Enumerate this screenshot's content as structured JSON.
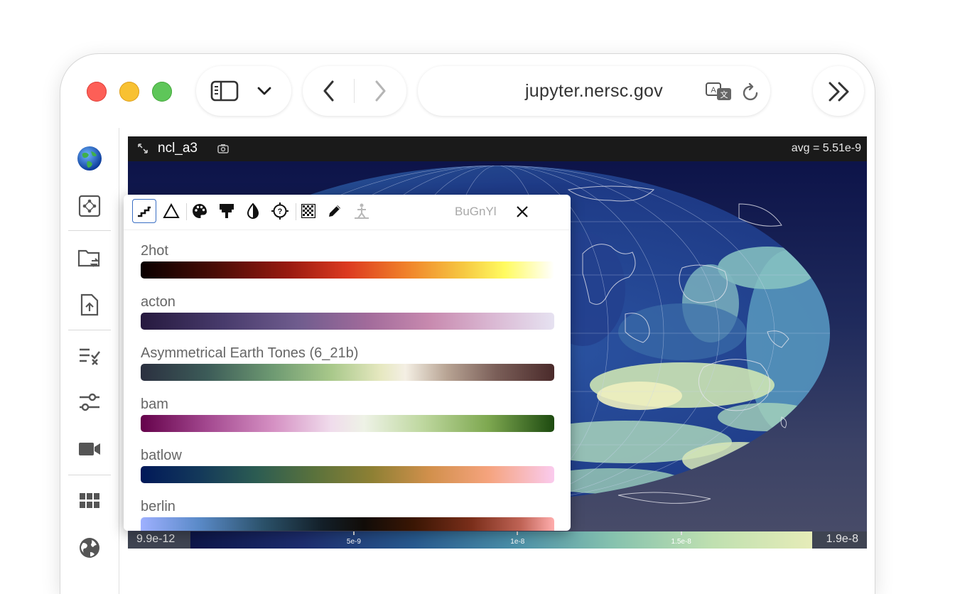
{
  "browser": {
    "url": "jupyter.nersc.gov"
  },
  "viewer": {
    "title": "ncl_a3",
    "avg": "avg = 5.51e-9",
    "colorbar": {
      "min": "9.9e-12",
      "max": "1.9e-8",
      "ticks": [
        {
          "label": "5e-9",
          "value": 5e-09
        },
        {
          "label": "1e-8",
          "value": 1e-08
        },
        {
          "label": "1.5e-8",
          "value": 1.5e-08
        }
      ]
    }
  },
  "colormap_panel": {
    "current": "BuGnYl",
    "toolbar_icons": [
      "stairs-icon",
      "triangle-icon",
      "palette-icon",
      "brush-icon",
      "contrast-icon",
      "crosshair-help-icon",
      "checkerboard-icon",
      "pencil-icon",
      "figure-icon"
    ],
    "items": [
      {
        "name": "2hot"
      },
      {
        "name": "acton"
      },
      {
        "name": "Asymmetrical Earth Tones (6_21b)"
      },
      {
        "name": "bam"
      },
      {
        "name": "batlow"
      },
      {
        "name": "berlin"
      }
    ]
  },
  "sidebar_icons": [
    "globe-icon",
    "network-icon",
    "folder-sync-icon",
    "file-upload-icon",
    "checklist-icon",
    "sliders-icon",
    "camera-icon",
    "grid-icon",
    "world-icon"
  ]
}
